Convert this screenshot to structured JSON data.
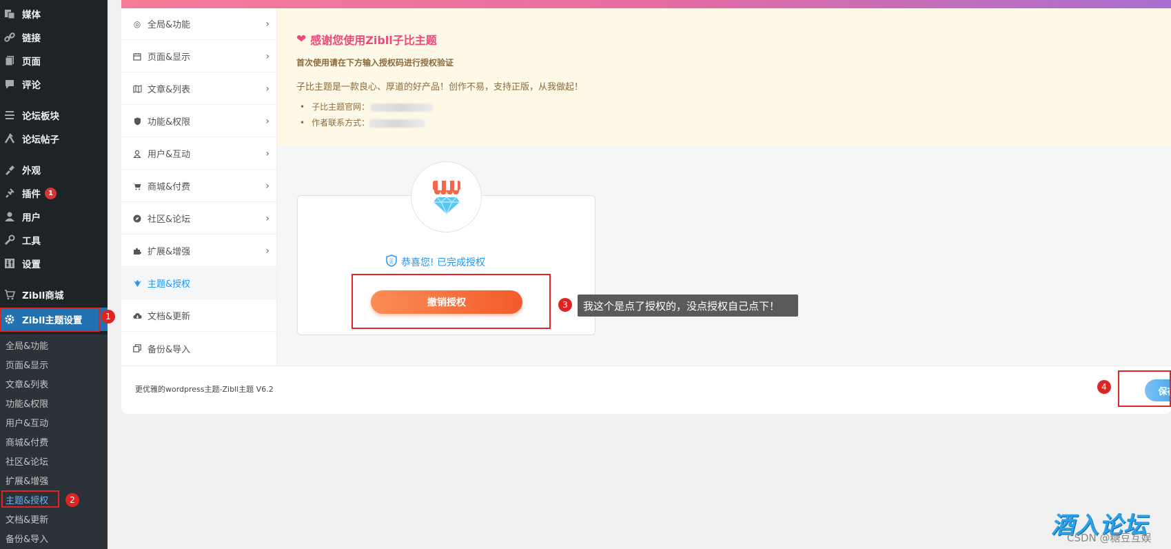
{
  "sidebar": {
    "menu": [
      {
        "label": "媒体",
        "icon": "media-icon"
      },
      {
        "label": "链接",
        "icon": "link-icon"
      },
      {
        "label": "页面",
        "icon": "page-icon"
      },
      {
        "label": "评论",
        "icon": "comment-icon"
      },
      {
        "label": "论坛板块",
        "icon": "forum-board-icon"
      },
      {
        "label": "论坛帖子",
        "icon": "forum-post-icon"
      },
      {
        "label": "外观",
        "icon": "appearance-icon"
      },
      {
        "label": "插件",
        "icon": "plugin-icon",
        "badge": "1"
      },
      {
        "label": "用户",
        "icon": "user-icon"
      },
      {
        "label": "工具",
        "icon": "tools-icon"
      },
      {
        "label": "设置",
        "icon": "settings-icon"
      },
      {
        "label": "Zibll商城",
        "icon": "cart-icon"
      },
      {
        "label": "Zibll主题设置",
        "icon": "gear-icon"
      }
    ],
    "submenu": [
      "全局&功能",
      "页面&显示",
      "文章&列表",
      "功能&权限",
      "用户&互动",
      "商城&付费",
      "社区&论坛",
      "扩展&增强",
      "主题&授权",
      "文档&更新",
      "备份&导入"
    ]
  },
  "settings_nav": [
    {
      "label": "全局&功能",
      "icon": "target-icon"
    },
    {
      "label": "页面&显示",
      "icon": "calendar-icon"
    },
    {
      "label": "文章&列表",
      "icon": "map-icon"
    },
    {
      "label": "功能&权限",
      "icon": "shield-icon"
    },
    {
      "label": "用户&互动",
      "icon": "user-icon"
    },
    {
      "label": "商城&付费",
      "icon": "cart-icon"
    },
    {
      "label": "社区&论坛",
      "icon": "compass-icon"
    },
    {
      "label": "扩展&增强",
      "icon": "puzzle-icon"
    },
    {
      "label": "主题&授权",
      "icon": "theme-icon"
    },
    {
      "label": "文档&更新",
      "icon": "cloud-download-icon"
    },
    {
      "label": "备份&导入",
      "icon": "copy-icon"
    }
  ],
  "notice": {
    "title": "感谢您使用Zibll子比主题",
    "subtitle": "首次使用请在下方输入授权码进行授权验证",
    "desc": "子比主题是一款良心、厚道的好产品！创作不易，支持正版，从我做起！",
    "items": [
      "子比主题官网：",
      "作者联系方式："
    ]
  },
  "auth": {
    "message": "恭喜您! 已完成授权",
    "revoke_label": "撤销授权"
  },
  "annotations": {
    "num1a": "1",
    "num1b": "1",
    "num2": "2",
    "num3": "3",
    "num4": "4",
    "tooltip": "我这个是点了授权的，没点授权自己点下！"
  },
  "footer": {
    "text": "更优雅的wordpress主题-Zibll主题 V6.2",
    "save_label": "保存"
  },
  "watermark": {
    "logo": "酒入论坛",
    "text": "CSDN @糖豆互娱"
  },
  "colors": {
    "sidebar_bg": "#1d2327",
    "active_blue": "#2271b1",
    "accent_pink": "#f0487a",
    "revoke_orange": "#f25b2b",
    "annotation_red": "#e02424"
  }
}
